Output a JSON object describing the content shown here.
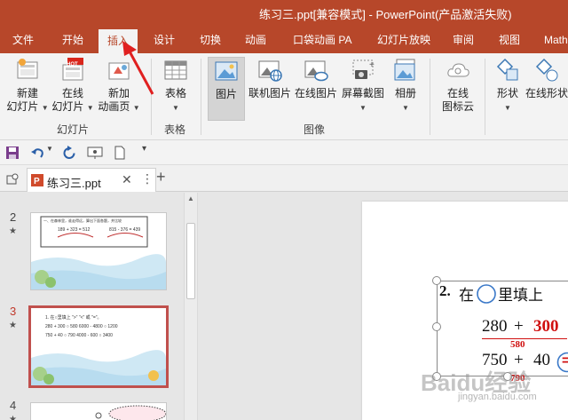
{
  "window": {
    "title": "练习三.ppt[兼容模式] - PowerPoint(产品激活失败)"
  },
  "tabs": [
    {
      "label": "文件"
    },
    {
      "label": "开始"
    },
    {
      "label": "插入"
    },
    {
      "label": "设计"
    },
    {
      "label": "切换"
    },
    {
      "label": "动画"
    },
    {
      "label": "口袋动画 PA"
    },
    {
      "label": "幻灯片放映"
    },
    {
      "label": "审阅"
    },
    {
      "label": "视图"
    },
    {
      "label": "Math"
    }
  ],
  "ribbon": {
    "new_slide": {
      "line1": "新建",
      "line2": "幻灯片"
    },
    "online_slide": {
      "line1": "在线",
      "line2": "幻灯片",
      "badge": "HOT"
    },
    "new_anim_page": {
      "line1": "新加",
      "line2": "动画页"
    },
    "group_slides": "幻灯片",
    "table": {
      "label": "表格"
    },
    "group_table": "表格",
    "picture": {
      "label": "图片"
    },
    "online_picture_1": {
      "label": "联机图片"
    },
    "online_picture_2": {
      "label": "在线图片"
    },
    "screenshot": {
      "label": "屏幕截图"
    },
    "album": {
      "label": "相册"
    },
    "group_images": "图像",
    "online_icon_cloud": {
      "line1": "在线",
      "line2": "图标云"
    },
    "shapes": {
      "label": "形状"
    },
    "online_shapes": {
      "label": "在线形状"
    }
  },
  "document": {
    "tab_name": "练习三.ppt"
  },
  "slides": [
    {
      "number": "2",
      "marker": "★",
      "header_text": "一、在森林里，谁走得远，算出下面各题，并比较",
      "expr1": "189 + 323 = 512",
      "expr2": "815 - 376 = 439"
    },
    {
      "number": "3",
      "marker": "★",
      "line1": "1. 在○里填上 \">\" \"<\" 或 \"=\"。",
      "line2": "280 + 300 ○ 580   6000 - 4800 ○ 1200",
      "line3": "750 + 40 ○ 790   4000 - 600 ○ 3400"
    },
    {
      "number": "4",
      "marker": "★"
    }
  ],
  "main_slide": {
    "heading_num": "2.",
    "heading_text1": "在",
    "heading_text2": "里填上",
    "row1_a": "280",
    "row1_op": "+",
    "row1_b": "300",
    "row1_sub": "580",
    "row2_a": "750",
    "row2_op": "+",
    "row2_b": "40",
    "row2_sub": "790",
    "comparison_sign": "=",
    "watermark": "Baidu经验",
    "watermark_url": "jingyan.baidu.com"
  },
  "colors": {
    "accent": "#b7472a",
    "red": "#d01010",
    "arrow": "#e02020"
  }
}
